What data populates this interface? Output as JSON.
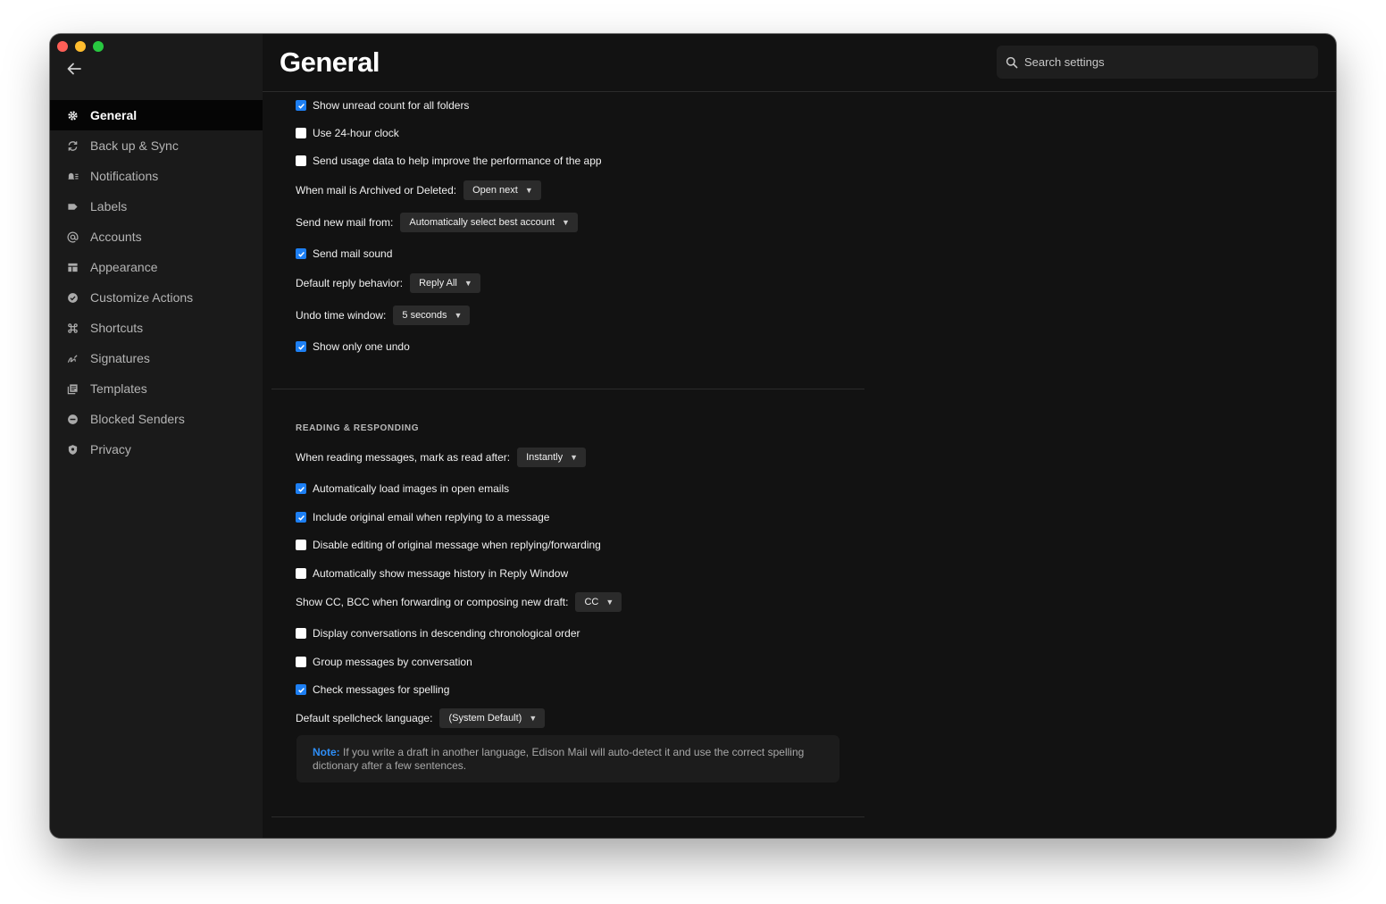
{
  "page": {
    "title": "General"
  },
  "search": {
    "placeholder": "Search settings"
  },
  "sidebar": {
    "items": [
      {
        "label": "General",
        "icon": "gear-icon"
      },
      {
        "label": "Back up & Sync",
        "icon": "sync-icon"
      },
      {
        "label": "Notifications",
        "icon": "bell-icon"
      },
      {
        "label": "Labels",
        "icon": "tag-icon"
      },
      {
        "label": "Accounts",
        "icon": "at-icon"
      },
      {
        "label": "Appearance",
        "icon": "layout-icon"
      },
      {
        "label": "Customize Actions",
        "icon": "check-circle-icon"
      },
      {
        "label": "Shortcuts",
        "icon": "command-icon"
      },
      {
        "label": "Signatures",
        "icon": "signature-icon"
      },
      {
        "label": "Templates",
        "icon": "templates-icon"
      },
      {
        "label": "Blocked Senders",
        "icon": "block-icon"
      },
      {
        "label": "Privacy",
        "icon": "shield-icon"
      }
    ]
  },
  "general": {
    "show_unread": {
      "label": "Show unread count for all folders",
      "checked": true
    },
    "clock_24h": {
      "label": "Use 24-hour clock",
      "checked": false
    },
    "usage_data": {
      "label": "Send usage data to help improve the performance of the app",
      "checked": false
    },
    "archived_deleted": {
      "label": "When mail is Archived or Deleted:",
      "value": "Open next"
    },
    "send_from": {
      "label": "Send new mail from:",
      "value": "Automatically select best account"
    },
    "send_sound": {
      "label": "Send mail sound",
      "checked": true
    },
    "reply_behavior": {
      "label": "Default reply behavior:",
      "value": "Reply All"
    },
    "undo_window": {
      "label": "Undo time window:",
      "value": "5 seconds"
    },
    "one_undo": {
      "label": "Show only one undo",
      "checked": true
    }
  },
  "reading": {
    "section_title": "READING & RESPONDING",
    "mark_read": {
      "label": "When reading messages, mark as read after:",
      "value": "Instantly"
    },
    "load_images": {
      "label": "Automatically load images in open emails",
      "checked": true
    },
    "include_original": {
      "label": "Include original email when replying to a message",
      "checked": true
    },
    "disable_editing": {
      "label": "Disable editing of original message when replying/forwarding",
      "checked": false
    },
    "show_history": {
      "label": "Automatically show message history in Reply Window",
      "checked": false
    },
    "show_cc": {
      "label": "Show CC, BCC when forwarding or composing new draft:",
      "value": "CC"
    },
    "descending": {
      "label": "Display conversations in descending chronological order",
      "checked": false
    },
    "group_conv": {
      "label": "Group messages by conversation",
      "checked": false
    },
    "spelling": {
      "label": "Check messages for spelling",
      "checked": true
    },
    "spell_lang": {
      "label": "Default spellcheck language:",
      "value": "(System Default)"
    },
    "note": {
      "label": "Note:",
      "text": " If you write a draft in another language, Edison Mail will auto-detect it and use the correct spelling dictionary after a few sentences."
    }
  },
  "colors": {
    "accent": "#1d7ff3",
    "note_label": "#2e8ef7",
    "background": "#121212",
    "sidebar": "#1a1a1a"
  }
}
